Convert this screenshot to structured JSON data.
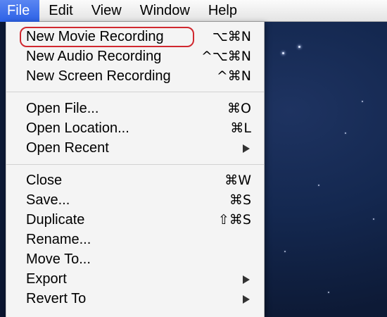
{
  "menubar": {
    "items": [
      {
        "label": "File"
      },
      {
        "label": "Edit"
      },
      {
        "label": "View"
      },
      {
        "label": "Window"
      },
      {
        "label": "Help"
      }
    ]
  },
  "file_menu": {
    "items": [
      {
        "label": "New Movie Recording",
        "shortcut": "⌥⌘N"
      },
      {
        "label": "New Audio Recording",
        "shortcut": "^⌥⌘N"
      },
      {
        "label": "New Screen Recording",
        "shortcut": "^⌘N"
      },
      {
        "label": "Open File...",
        "shortcut": "⌘O"
      },
      {
        "label": "Open Location...",
        "shortcut": "⌘L"
      },
      {
        "label": "Open Recent",
        "submenu": true
      },
      {
        "label": "Close",
        "shortcut": "⌘W"
      },
      {
        "label": "Save...",
        "shortcut": "⌘S"
      },
      {
        "label": "Duplicate",
        "shortcut": "⇧⌘S"
      },
      {
        "label": "Rename..."
      },
      {
        "label": "Move To..."
      },
      {
        "label": "Export",
        "submenu": true
      },
      {
        "label": "Revert To",
        "submenu": true
      }
    ]
  },
  "colors": {
    "highlight_ring": "#d0282f",
    "active_menu_bg": "#2c61e6"
  }
}
